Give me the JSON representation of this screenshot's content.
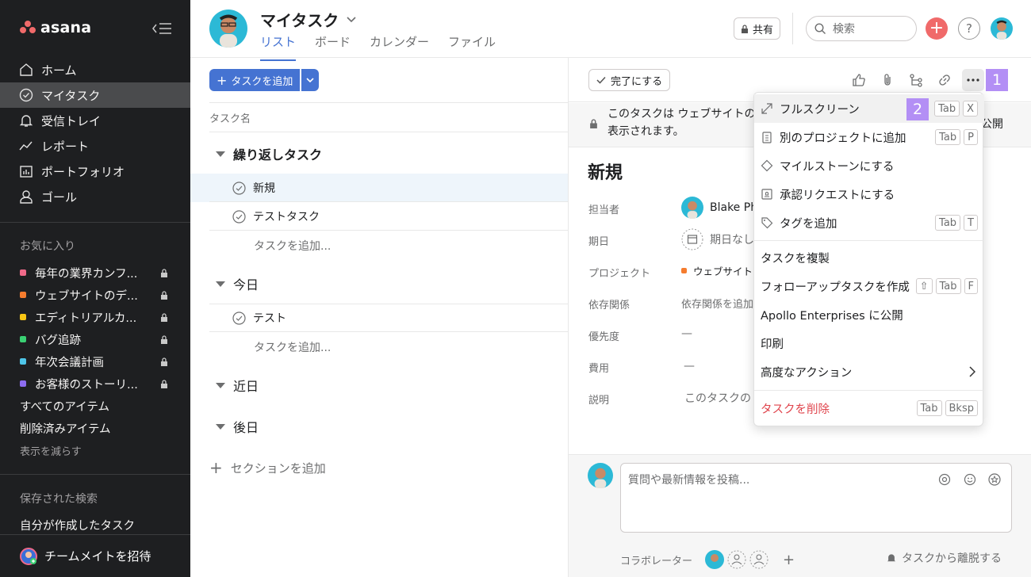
{
  "sidebar": {
    "logo": "asana",
    "nav": [
      {
        "label": "ホーム",
        "icon": "home-icon"
      },
      {
        "label": "マイタスク",
        "icon": "check-circle-icon"
      },
      {
        "label": "受信トレイ",
        "icon": "bell-icon"
      },
      {
        "label": "レポート",
        "icon": "trend-line-icon"
      },
      {
        "label": "ポートフォリオ",
        "icon": "portfolio-icon"
      },
      {
        "label": "ゴール",
        "icon": "person-icon"
      }
    ],
    "favorites_label": "お気に入り",
    "favorites": [
      {
        "label": "毎年の業界カンフ...",
        "color": "#f06a8a"
      },
      {
        "label": "ウェブサイトのデ...",
        "color": "#f57c2e"
      },
      {
        "label": "エディトリアルカ...",
        "color": "#f8c514"
      },
      {
        "label": "バグ追跡",
        "color": "#3ad073"
      },
      {
        "label": "年次会議計画",
        "color": "#4ec5e8"
      },
      {
        "label": "お客様のストーリ...",
        "color": "#8d6cf0"
      }
    ],
    "all_items": "すべてのアイテム",
    "deleted_items": "削除済みアイテム",
    "show_less": "表示を減らす",
    "saved_searches_label": "保存された検索",
    "saved_search": "自分が作成したタスク",
    "invite": "チームメイトを招待"
  },
  "header": {
    "title": "マイタスク",
    "tabs": [
      "リスト",
      "ボード",
      "カレンダー",
      "ファイル"
    ],
    "share": "共有",
    "search_placeholder": "検索",
    "help": "?"
  },
  "list": {
    "add_task": "タスクを追加",
    "column_header": "タスク名",
    "sections": [
      {
        "title": "繰り返しタスク",
        "tasks": [
          "新規",
          "テストタスク"
        ],
        "add": "タスクを追加..."
      },
      {
        "title": "今日",
        "tasks": [
          "テスト"
        ],
        "add": "タスクを追加..."
      },
      {
        "title": "近日",
        "tasks": []
      },
      {
        "title": "後日",
        "tasks": []
      }
    ],
    "add_section": "セクションを追加"
  },
  "detail": {
    "complete": "完了にする",
    "notice_line1": "このタスクは ウェブサイトの",
    "notice_line2": "表示されます。",
    "notice_right": "公開",
    "title": "新規",
    "fields": [
      {
        "label": "担当者",
        "value": "Blake Ph"
      },
      {
        "label": "期日",
        "value": "期日なし"
      },
      {
        "label": "プロジェクト",
        "value": "ウェブサイトの"
      },
      {
        "label": "依存関係",
        "value": "依存関係を追加"
      },
      {
        "label": "優先度",
        "value": "—"
      },
      {
        "label": "費用",
        "value": "—"
      },
      {
        "label": "説明",
        "value": "このタスクの"
      }
    ],
    "comment_placeholder": "質問や最新情報を投稿...",
    "collaborators": "コラボレーター",
    "leave": "タスクから離脱する"
  },
  "menu": {
    "items": [
      {
        "label": "フルスクリーン",
        "keys": [
          "Tab",
          "X"
        ]
      },
      {
        "label": "別のプロジェクトに追加",
        "keys": [
          "Tab",
          "P"
        ]
      },
      {
        "label": "マイルストーンにする",
        "keys": []
      },
      {
        "label": "承認リクエストにする",
        "keys": []
      },
      {
        "label": "タグを追加",
        "keys": [
          "Tab",
          "T"
        ]
      },
      {
        "label": "タスクを複製",
        "keys": []
      },
      {
        "label": "フォローアップタスクを作成",
        "keys": [
          "⇧",
          "Tab",
          "F"
        ]
      },
      {
        "label": "Apollo Enterprises に公開",
        "keys": []
      },
      {
        "label": "印刷",
        "keys": []
      },
      {
        "label": "高度なアクション",
        "keys": []
      },
      {
        "label": "タスクを削除",
        "keys": [
          "Tab",
          "Bksp"
        ]
      }
    ]
  },
  "badges": {
    "one": "1",
    "two": "2"
  },
  "colors": {
    "accent": "#4573d2",
    "sidebar_bg": "#1e1f21",
    "danger": "#e0454d",
    "badge": "#b38ff5"
  }
}
